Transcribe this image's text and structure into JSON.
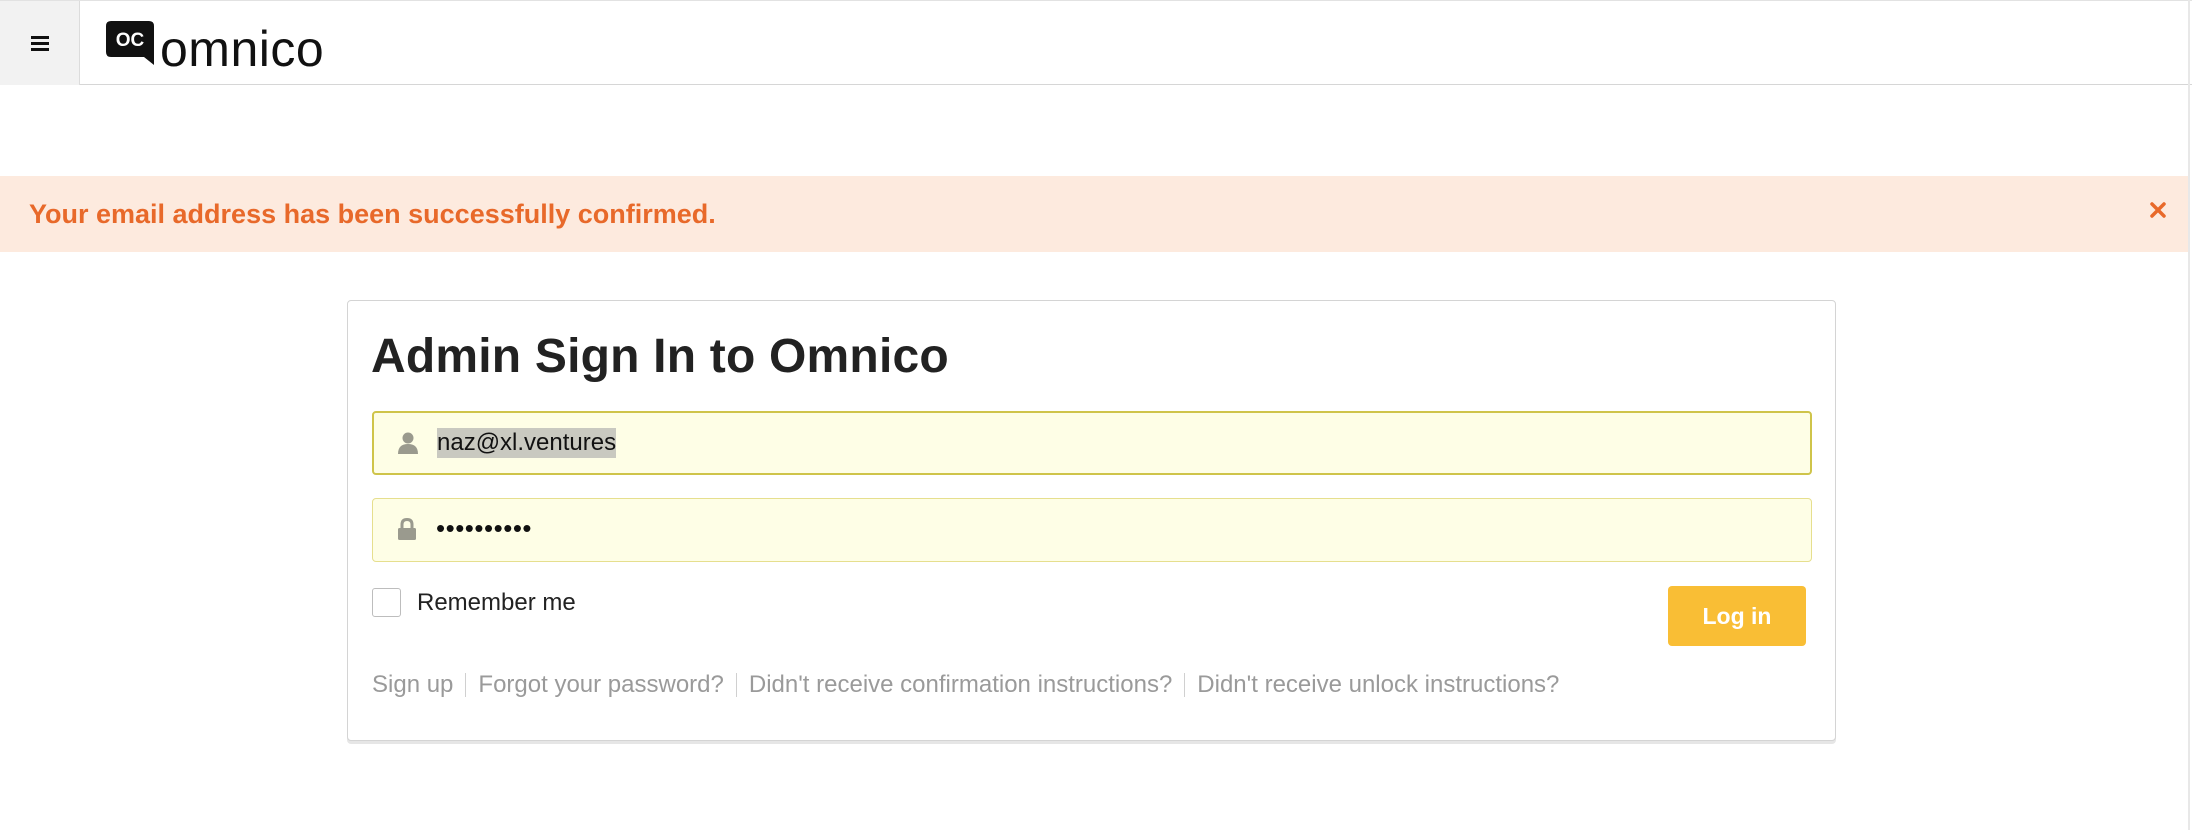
{
  "header": {
    "menu_icon": "hamburger-icon",
    "logo_mark_text": "OC",
    "logo_text": "omnico"
  },
  "flash": {
    "message": "Your email address has been successfully confirmed.",
    "close_icon": "close-icon",
    "text_color": "#e8692a",
    "background_color": "#fdeade"
  },
  "signin": {
    "title": "Admin Sign In to Omnico",
    "email": {
      "icon": "user-icon",
      "value": "naz@xl.ventures"
    },
    "password": {
      "icon": "lock-icon",
      "value": "••••••••••"
    },
    "remember_label": "Remember me",
    "remember_checked": false,
    "login_label": "Log in",
    "login_color": "#f9be35",
    "links": [
      "Sign up",
      "Forgot your password?",
      "Didn't receive confirmation instructions?",
      "Didn't receive unlock instructions?"
    ]
  }
}
